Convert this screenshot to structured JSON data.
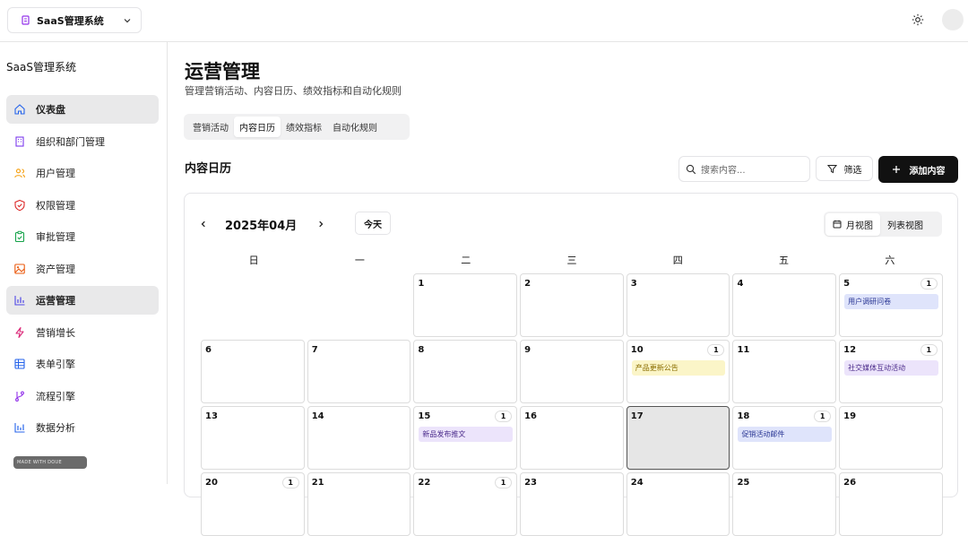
{
  "topbar": {
    "app_name": "SaaS管理系统"
  },
  "sidebar": {
    "title": "SaaS管理系统",
    "items": [
      {
        "label": "仪表盘",
        "icon": "home-icon",
        "color": "#2563eb",
        "active": true
      },
      {
        "label": "组织和部门管理",
        "icon": "building-icon",
        "color": "#7c3aed"
      },
      {
        "label": "用户管理",
        "icon": "users-icon",
        "color": "#f59e0b"
      },
      {
        "label": "权限管理",
        "icon": "shield-icon",
        "color": "#dc2626"
      },
      {
        "label": "审批管理",
        "icon": "clipboard-check-icon",
        "color": "#16a34a"
      },
      {
        "label": "资产管理",
        "icon": "image-icon",
        "color": "#ea580c"
      },
      {
        "label": "运营管理",
        "icon": "bar-chart-icon",
        "color": "#4f46e5",
        "active": true
      },
      {
        "label": "营销增长",
        "icon": "zap-icon",
        "color": "#db2777"
      },
      {
        "label": "表单引擎",
        "icon": "table-icon",
        "color": "#2563eb"
      },
      {
        "label": "流程引擎",
        "icon": "git-branch-icon",
        "color": "#9333ea"
      },
      {
        "label": "数据分析",
        "icon": "chart-icon",
        "color": "#2563eb"
      }
    ],
    "made_with": "MADE WITH DOUE"
  },
  "main": {
    "title": "运营管理",
    "subtitle": "管理营销活动、内容日历、绩效指标和自动化规则",
    "tabs": [
      {
        "label": "营销活动"
      },
      {
        "label": "内容日历",
        "active": true
      },
      {
        "label": "绩效指标"
      },
      {
        "label": "自动化规则"
      }
    ],
    "section_title": "内容日历",
    "search_placeholder": "搜索内容...",
    "filter_label": "筛选",
    "add_label": "添加内容"
  },
  "calendar": {
    "month_label": "2025年04月",
    "today_label": "今天",
    "views": [
      {
        "label": "月视图",
        "icon": "calendar-icon",
        "active": true
      },
      {
        "label": "列表视图"
      }
    ],
    "weekdays": [
      "日",
      "一",
      "二",
      "三",
      "四",
      "五",
      "六"
    ],
    "rows": [
      [
        {
          "day": ""
        },
        {
          "day": ""
        },
        {
          "day": "1"
        },
        {
          "day": "2"
        },
        {
          "day": "3"
        },
        {
          "day": "4"
        },
        {
          "day": "5",
          "count": "1",
          "event": "用户调研问卷",
          "event_color": "blue"
        }
      ],
      [
        {
          "day": "6"
        },
        {
          "day": "7"
        },
        {
          "day": "8"
        },
        {
          "day": "9"
        },
        {
          "day": "10",
          "count": "1",
          "event": "产品更新公告",
          "event_color": "yellow"
        },
        {
          "day": "11"
        },
        {
          "day": "12",
          "count": "1",
          "event": "社交媒体互动活动",
          "event_color": "purple"
        }
      ],
      [
        {
          "day": "13"
        },
        {
          "day": "14"
        },
        {
          "day": "15",
          "count": "1",
          "event": "新品发布推文",
          "event_color": "purple"
        },
        {
          "day": "16"
        },
        {
          "day": "17",
          "today": true
        },
        {
          "day": "18",
          "count": "1",
          "event": "促销活动邮件",
          "event_color": "blue"
        },
        {
          "day": "19"
        }
      ],
      [
        {
          "day": "20",
          "count": "1"
        },
        {
          "day": "21"
        },
        {
          "day": "22",
          "count": "1"
        },
        {
          "day": "23"
        },
        {
          "day": "24"
        },
        {
          "day": "25"
        },
        {
          "day": "26"
        }
      ]
    ]
  }
}
